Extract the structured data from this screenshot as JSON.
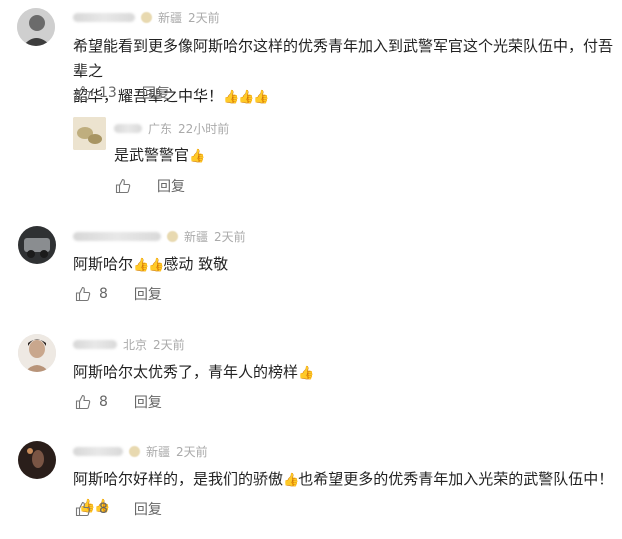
{
  "icons": {
    "like": "thumbs-up-outline-icon",
    "emoji": "thumbs-up-emoji-icon"
  },
  "colors": {
    "emoji": "#e8a200",
    "meta": "#aaaaaa"
  },
  "comments": [
    {
      "location": "新疆",
      "time": "2天前",
      "line1": "希望能看到更多像阿斯哈尔这样的优秀青年加入到武警军官这个光荣队伍中，付吾辈之",
      "line2": "韶华，耀吾辈之中华！",
      "emoji": "👍👍👍",
      "likes": "13",
      "reply": "回复",
      "sub_reply": {
        "location": "广东",
        "time": "22小时前",
        "text": "是武警警官",
        "emoji": "👍",
        "reply": "回复"
      }
    },
    {
      "location": "新疆",
      "time": "2天前",
      "text_a": "阿斯哈尔",
      "emoji_a": "👍👍",
      "text_b": "感动 致敬",
      "likes": "8",
      "reply": "回复"
    },
    {
      "location": "北京",
      "time": "2天前",
      "text_a": "阿斯哈尔太优秀了，青年人的榜样",
      "emoji_a": "👍",
      "likes": "8",
      "reply": "回复"
    },
    {
      "location": "新疆",
      "time": "2天前",
      "text_a": "阿斯哈尔好样的，是我们的骄傲",
      "emoji_a": "👍",
      "text_b": "也希望更多的优秀青年加入光荣的武警队伍中！",
      "emoji_b": "👍👍",
      "likes": "8",
      "reply": "回复"
    }
  ]
}
